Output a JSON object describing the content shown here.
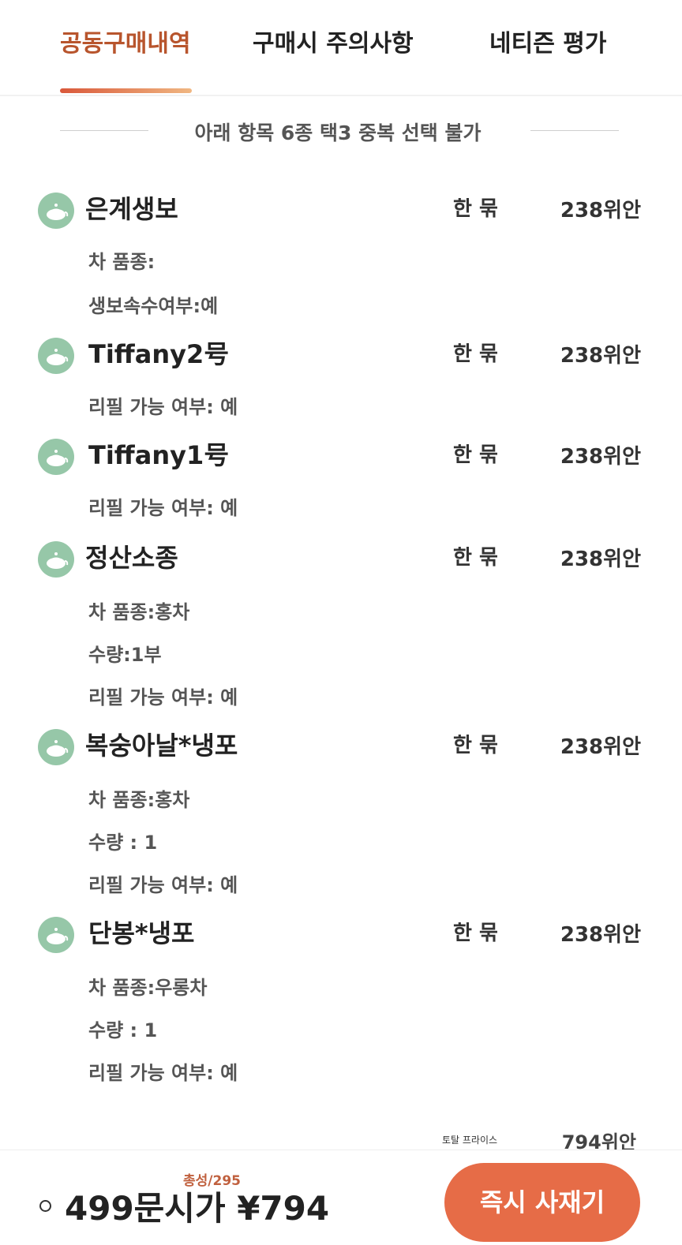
{
  "tabs": [
    {
      "label": "공동구매내역",
      "active": true
    },
    {
      "label": "구매시 주의사항",
      "active": false
    },
    {
      "label": "네티즌 평가",
      "active": false
    }
  ],
  "notice": "아래 항목 6종 택3 중복 선택 불가",
  "items": [
    {
      "name": "은계생보",
      "unit": "한 묶",
      "price": "238위안",
      "details": [
        "차 품종:",
        "생보속수여부:예"
      ]
    },
    {
      "name": "Tiffany2号",
      "unit": "한 묶",
      "price": "238위안",
      "details": [
        "리필 가능 여부: 예"
      ]
    },
    {
      "name": "Tiffany1号",
      "unit": "한 묶",
      "price": "238위안",
      "details": [
        "리필 가능 여부: 예"
      ]
    },
    {
      "name": "정산소종",
      "unit": "한 묶",
      "price": "238위안",
      "details": [
        "차 품종:홍차",
        "수량:1부",
        "리필 가능 여부: 예"
      ]
    },
    {
      "name": "복숭아날*냉포",
      "unit": "한 묶",
      "price": "238위안",
      "details": [
        "차 품종:홍차",
        "수량 : 1",
        "리필 가능 여부: 예"
      ]
    },
    {
      "name": "단봉*냉포",
      "unit": "한 묶",
      "price": "238위안",
      "details": [
        "차 품종:우롱차",
        "수량 : 1",
        "리필 가능 여부: 예"
      ]
    }
  ],
  "total": {
    "label": "토탈 프라이스",
    "value": "794위안"
  },
  "bottom": {
    "sold": "총성/295",
    "price": "499문시가 ¥794",
    "buy_label": "즉시 사재기"
  },
  "colors": {
    "accent": "#b8552d",
    "button": "#e66c47",
    "icon_bg": "#96c7a8"
  }
}
